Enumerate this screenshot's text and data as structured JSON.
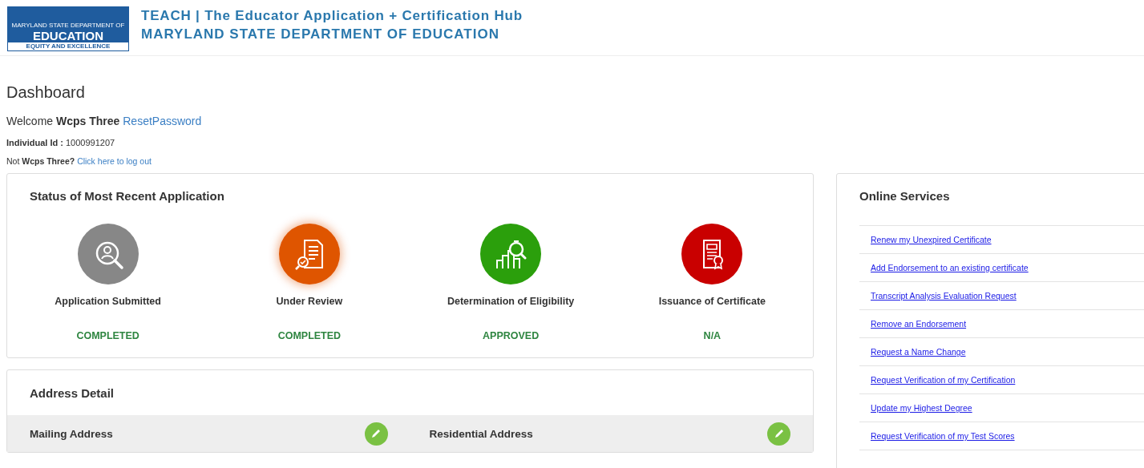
{
  "header": {
    "logo": {
      "line_1": "MARYLAND STATE DEPARTMENT OF",
      "line_2": "EDUCATION",
      "line_3": "EQUITY AND EXCELLENCE"
    },
    "title": "TEACH | The Educator Application + Certification Hub",
    "subtitle": "MARYLAND STATE DEPARTMENT OF EDUCATION"
  },
  "page_title": "Dashboard",
  "welcome": {
    "text": "Welcome **Wcps Three**",
    "link": "ResetPassword"
  },
  "individual_id": {
    "label": "Individual Id :",
    "value": "1000991207"
  },
  "logout": {
    "text": "Not **Wcps Three?**",
    "link": "Click here to log out"
  },
  "status_panel": {
    "title": "Status of Most Recent Application",
    "steps": [
      {
        "kind": "search-person",
        "color": "#878787",
        "label": "Application Submitted",
        "status": "COMPLETED",
        "current": false
      },
      {
        "kind": "document-check",
        "color": "#df5500",
        "label": "Under Review",
        "status": "COMPLETED",
        "current": true
      },
      {
        "kind": "chart-search",
        "color": "#2b9f0c",
        "label": "Determination of Eligibility",
        "status": "APPROVED",
        "current": false
      },
      {
        "kind": "certificate",
        "color": "#c90000",
        "label": "Issuance of Certificate",
        "status": "N/A",
        "current": false
      }
    ]
  },
  "address_panel": {
    "title": "Address Detail",
    "columns": [
      {
        "label": "Mailing Address"
      },
      {
        "label": "Residential Address"
      }
    ]
  },
  "online_services": {
    "title": "Online Services",
    "links": [
      "Renew my Unexpired Certificate",
      "Add Endorsement to an existing certificate",
      "Transcript Analysis Evaluation Request",
      "Remove an Endorsement",
      "Request a Name Change",
      "Request Verification of my Certification",
      "Update my Highest Degree",
      "Request Verification of my Test Scores"
    ]
  }
}
